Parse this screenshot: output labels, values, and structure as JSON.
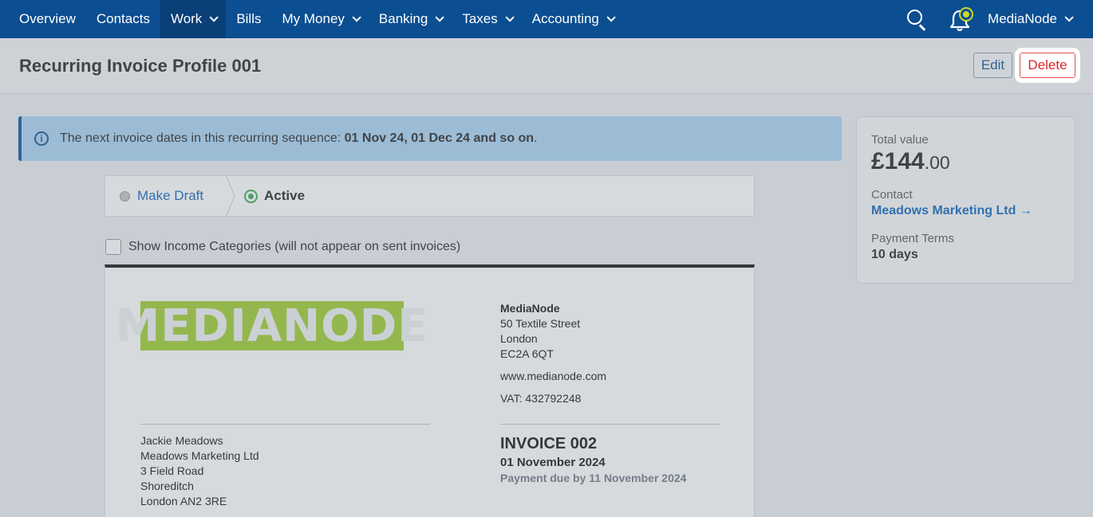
{
  "nav": {
    "items": [
      {
        "label": "Overview",
        "dropdown": false,
        "active": false
      },
      {
        "label": "Contacts",
        "dropdown": false,
        "active": false
      },
      {
        "label": "Work",
        "dropdown": true,
        "active": true
      },
      {
        "label": "Bills",
        "dropdown": false,
        "active": false
      },
      {
        "label": "My Money",
        "dropdown": true,
        "active": false
      },
      {
        "label": "Banking",
        "dropdown": true,
        "active": false
      },
      {
        "label": "Taxes",
        "dropdown": true,
        "active": false
      },
      {
        "label": "Accounting",
        "dropdown": true,
        "active": false
      }
    ],
    "user_label": "MediaNode",
    "accent": "#0b4e91"
  },
  "header": {
    "title": "Recurring Invoice Profile 001",
    "edit_label": "Edit",
    "delete_label": "Delete"
  },
  "banner": {
    "text": "The next invoice dates in this recurring sequence: ",
    "dates": "01 Nov 24, 01 Dec 24 and so on",
    "suffix": "."
  },
  "status": {
    "draft_label": "Make Draft",
    "active_label": "Active"
  },
  "options": {
    "show_categories_label": "Show Income Categories (will not appear on sent invoices)"
  },
  "invoice": {
    "logo_text": "MEDIANODE",
    "from": {
      "name": "MediaNode",
      "street": "50 Textile Street",
      "city": "London",
      "postcode": "EC2A 6QT",
      "website": "www.medianode.com",
      "vat": "VAT: 432792248"
    },
    "to": {
      "person": "Jackie Meadows",
      "company": "Meadows Marketing Ltd",
      "street": "3 Field Road",
      "area": "Shoreditch",
      "city": "London AN2 3RE"
    },
    "number": "INVOICE 002",
    "date": "01 November 2024",
    "due": "Payment due by 11 November 2024"
  },
  "summary": {
    "total_label": "Total value",
    "total_pounds": "£144",
    "total_pence": ".00",
    "contact_label": "Contact",
    "contact_name": "Meadows Marketing Ltd →",
    "terms_label": "Payment Terms",
    "terms_value": "10 days"
  }
}
